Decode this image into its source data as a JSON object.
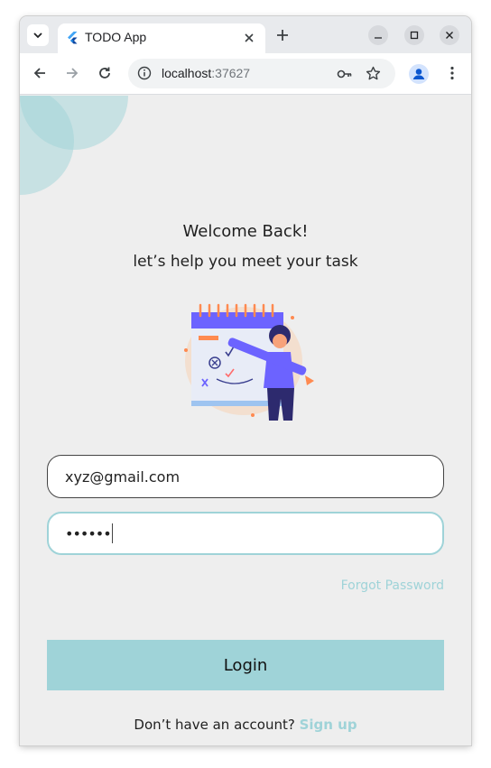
{
  "browser": {
    "tab_title": "TODO App",
    "url_host": "localhost",
    "url_port": ":37627"
  },
  "page": {
    "welcome": "Welcome Back!",
    "subtitle": "let’s help you meet your task",
    "email_value": "xyz@gmail.com",
    "password_value": "••••••",
    "forgot_password": "Forgot Password",
    "login_label": "Login",
    "signup_prompt": "Don’t have an account?",
    "signup_link": "Sign up"
  },
  "colors": {
    "accent": "#9fd3d8",
    "background": "#eeeeee"
  }
}
